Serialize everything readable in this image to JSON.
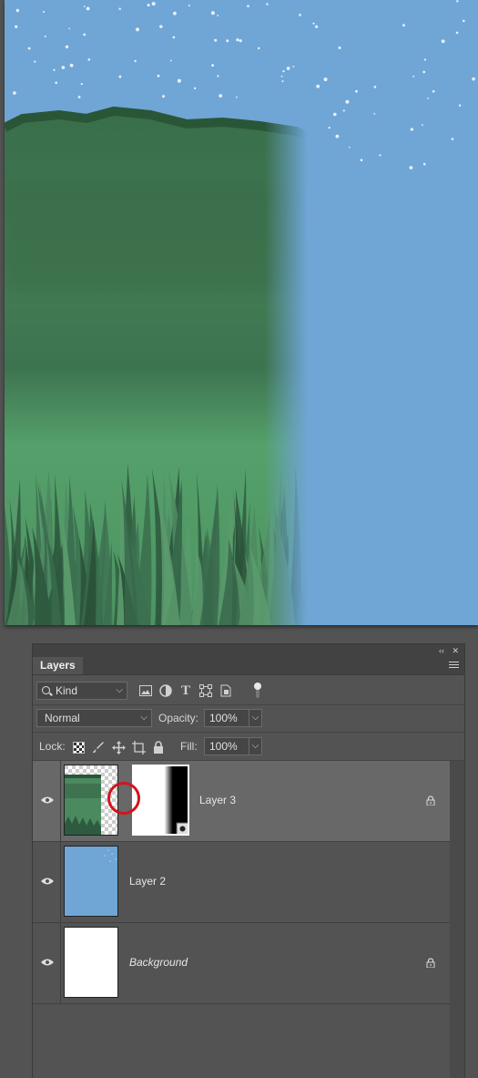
{
  "panel": {
    "title": "Layers",
    "collapse_icon": "double-chevron-left-icon",
    "close_icon": "close-icon",
    "menu_icon": "hamburger-menu-icon",
    "collapse_glyph": "‹‹",
    "close_glyph": "✕"
  },
  "filter": {
    "kind_label": "Kind",
    "icons": [
      "image-filter-icon",
      "adjustment-filter-icon",
      "type-filter-icon",
      "shape-filter-icon",
      "smart-object-filter-icon"
    ],
    "type_glyph": "T"
  },
  "blend": {
    "mode": "Normal",
    "opacity_label": "Opacity:",
    "opacity_value": "100%"
  },
  "lock": {
    "label": "Lock:",
    "fill_label": "Fill:",
    "fill_value": "100%",
    "icons": [
      "lock-transparent-pixels-icon",
      "lock-image-pixels-icon",
      "lock-position-icon",
      "lock-artboard-icon",
      "lock-all-icon"
    ]
  },
  "layers": [
    {
      "name": "Layer 3",
      "selected": true,
      "visible": true,
      "locked": true,
      "has_mask": true
    },
    {
      "name": "Layer 2",
      "selected": false,
      "visible": true,
      "locked": false,
      "has_mask": false
    },
    {
      "name": "Background",
      "selected": false,
      "visible": true,
      "locked": true,
      "has_mask": false
    }
  ],
  "colors": {
    "sky": "#6fa6d6",
    "forest_dark": "#2f5a3e",
    "forest_mid": "#4a8a5e",
    "panel_bg": "#535353",
    "selected_row": "#686868",
    "annotation_red": "#d4141c"
  }
}
